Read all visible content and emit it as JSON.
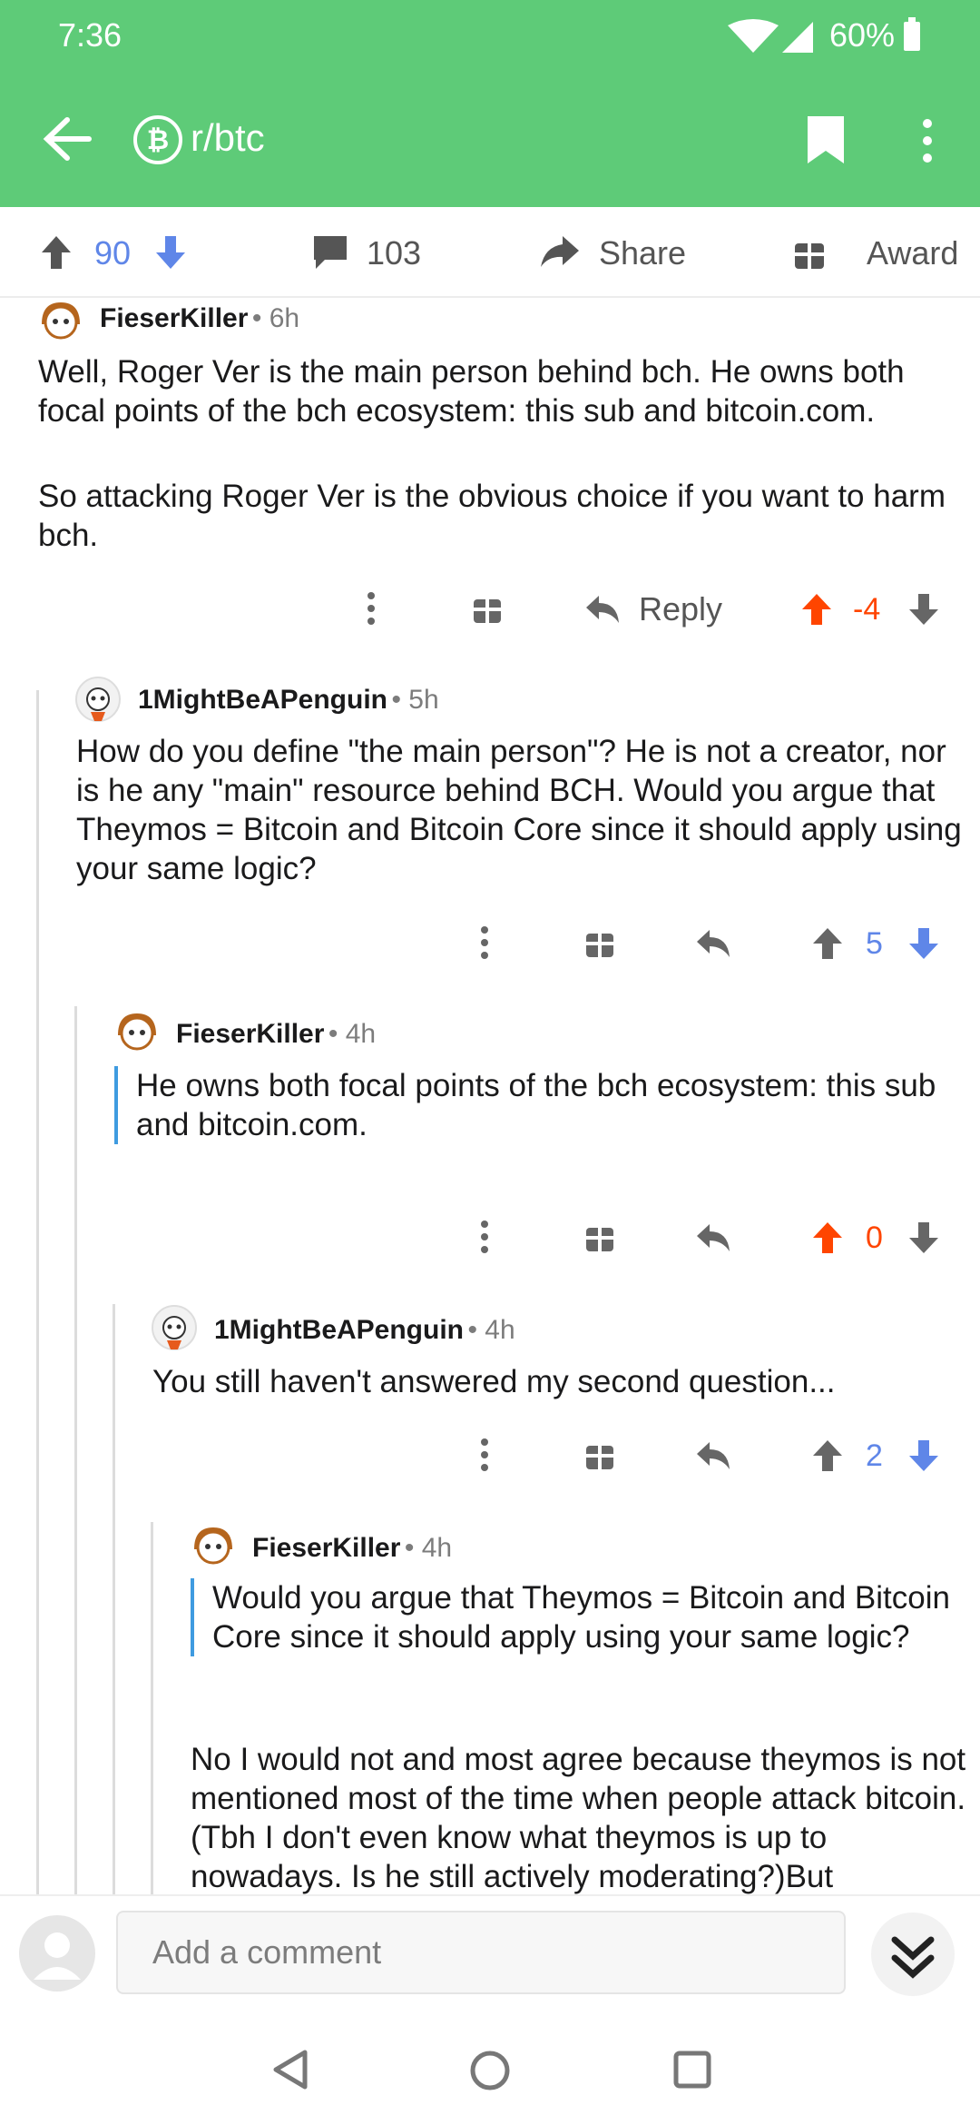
{
  "status": {
    "time": "7:36",
    "battery": "60%"
  },
  "appbar": {
    "subreddit": "r/btc",
    "icons": [
      "back-arrow-icon",
      "bitcoin-icon",
      "bookmark-icon",
      "overflow-menu-icon"
    ]
  },
  "actions": {
    "score": "90",
    "comments": "103",
    "share": "Share",
    "award": "Award"
  },
  "comments": [
    {
      "author": "FieserKiller",
      "time": "6h",
      "para1": "Well, Roger Ver is the main person behind bch. He owns both focal points of the bch ecosystem:  this sub and bitcoin.com.",
      "para2": "So attacking Roger Ver is the obvious choice if you want to harm bch.",
      "reply": "Reply",
      "score": "-4"
    },
    {
      "author": "1MightBeAPenguin",
      "time": "5h",
      "body": "How do you define \"the main person\"? He is not a creator, nor is he any \"main\" resource behind BCH. Would you argue that Theymos = Bitcoin and Bitcoin Core since it should apply using your same logic?",
      "score": "5"
    },
    {
      "author": "FieserKiller",
      "time": "4h",
      "quote": "He owns both focal points of the bch ecosystem:  this sub and bitcoin.com.",
      "score": "0"
    },
    {
      "author": "1MightBeAPenguin",
      "time": "4h",
      "body": "You still haven't answered my second question...",
      "score": "2"
    },
    {
      "author": "FieserKiller",
      "time": "4h",
      "quote": "Would you argue that Theymos = Bitcoin and Bitcoin Core since it should apply using your same logic?",
      "body": "No I would not and most agree because theymos is not mentioned most of the time when people attack bitcoin. (Tbh I don't even know what theymos is up to nowadays. Is he still actively moderating?)But"
    }
  ],
  "composer": {
    "placeholder": "Add a comment"
  },
  "colors": {
    "header": "#5ecb78",
    "upvote": "#ff4500",
    "downvote": "#5f86e8",
    "quote_bar": "#3f9be0"
  }
}
